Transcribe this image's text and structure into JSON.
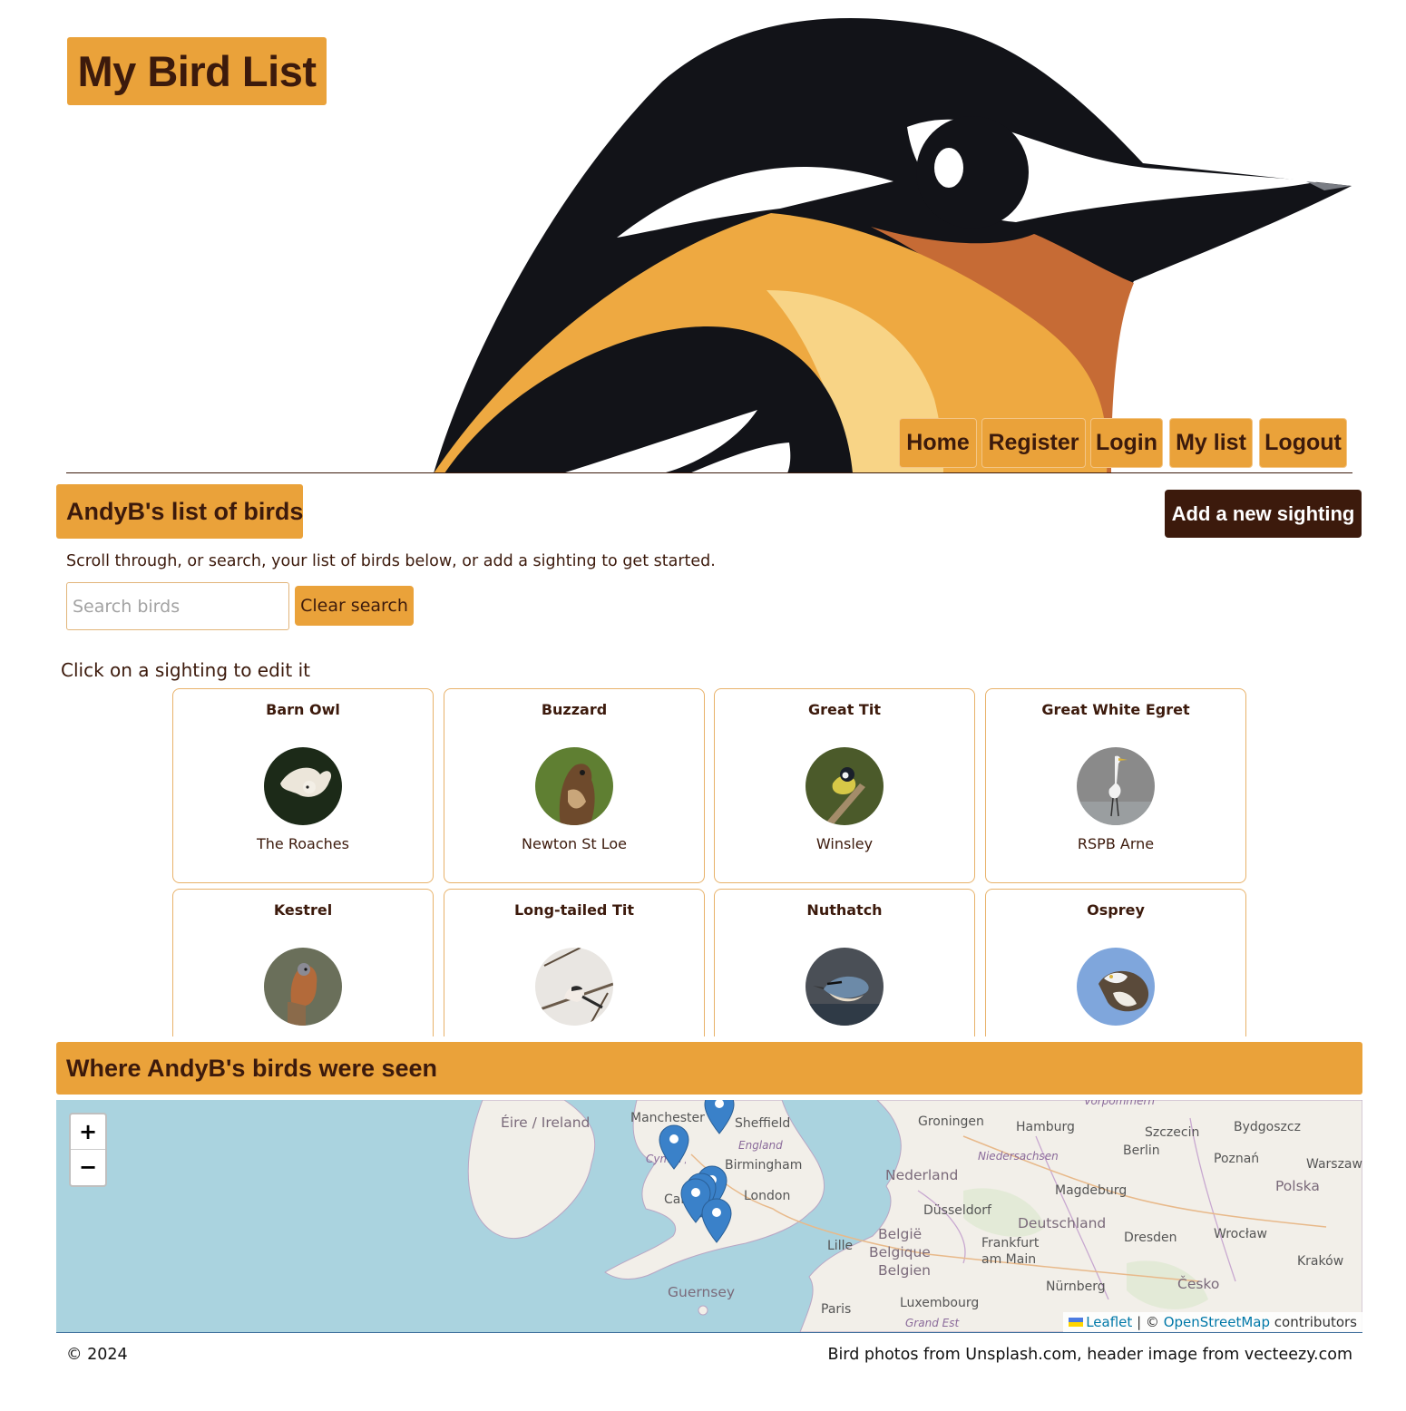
{
  "header": {
    "site_title": "My Bird List",
    "hero_image": "stylised bird head illustration",
    "nav": [
      "Home",
      "Register",
      "Login",
      "My list",
      "Logout"
    ]
  },
  "list_section": {
    "heading": "AndyB's list of birds",
    "add_button": "Add a new sighting",
    "intro": "Scroll through, or search, your list of birds below, or add a sighting to get started.",
    "search_placeholder": "Search birds",
    "search_value": "",
    "clear_button": "Clear search",
    "edit_hint": "Click on a sighting to edit it"
  },
  "sightings": [
    {
      "bird": "Barn Owl",
      "location": "The Roaches",
      "photo_bg": "#1c2a18"
    },
    {
      "bird": "Buzzard",
      "location": "Newton St Loe",
      "photo_bg": "#5f7f32"
    },
    {
      "bird": "Great Tit",
      "location": "Winsley",
      "photo_bg": "#4b5a2a"
    },
    {
      "bird": "Great White Egret",
      "location": "RSPB Arne",
      "photo_bg": "#8a8a8a"
    },
    {
      "bird": "Kestrel",
      "location": "",
      "photo_bg": "#6a6f5a"
    },
    {
      "bird": "Long-tailed Tit",
      "location": "",
      "photo_bg": "#e9e6e2"
    },
    {
      "bird": "Nuthatch",
      "location": "",
      "photo_bg": "#4a4f56"
    },
    {
      "bird": "Osprey",
      "location": "",
      "photo_bg": "#7fa6dc"
    }
  ],
  "map_section": {
    "heading": "Where AndyB's birds were seen",
    "zoom_in": "+",
    "zoom_out": "−",
    "place_labels": {
      "ireland": "Éire / Ireland",
      "manchester": "Manchester",
      "sheffield": "Sheffield",
      "england": "England",
      "birmingham": "Birmingham",
      "wales": "Cymru / Wales",
      "cardiff": "Cardiff",
      "london": "London",
      "guernsey": "Guernsey",
      "groningen": "Groningen",
      "hamburg": "Hamburg",
      "niedersachsen": "Niedersachsen",
      "nederland": "Nederland",
      "vorpommern": "Vorpommern",
      "szczecin": "Szczecin",
      "bydgoszcz": "Bydgoszcz",
      "berlin": "Berlin",
      "poznan": "Poznań",
      "warszawa": "Warszawa",
      "magdeburg": "Magdeburg",
      "polska": "Polska",
      "dusseldorf": "Düsseldorf",
      "deutschland": "Deutschland",
      "belgie": "België",
      "belgique": "Belgique",
      "belgien": "Belgien",
      "lille": "Lille",
      "frankfurt": "Frankfurt am Main",
      "dresden": "Dresden",
      "wroclaw": "Wrocław",
      "krakow": "Kraków",
      "nurnberg": "Nürnberg",
      "cesko": "Česko",
      "luxembourg": "Luxembourg",
      "paris": "Paris",
      "grand_est": "Grand Est"
    },
    "attribution": {
      "leaflet": "Leaflet",
      "separator": "| ©",
      "osm": "OpenStreetMap",
      "contributors": "contributors"
    },
    "marker_color": "#3a81c9"
  },
  "footer": {
    "copyright": "© 2024",
    "credits": "Bird photos from Unsplash.com, header image from vecteezy.com"
  },
  "colors": {
    "accent": "#eaa23a",
    "dark": "#3c1a0c",
    "card_border": "#e8b26a"
  }
}
